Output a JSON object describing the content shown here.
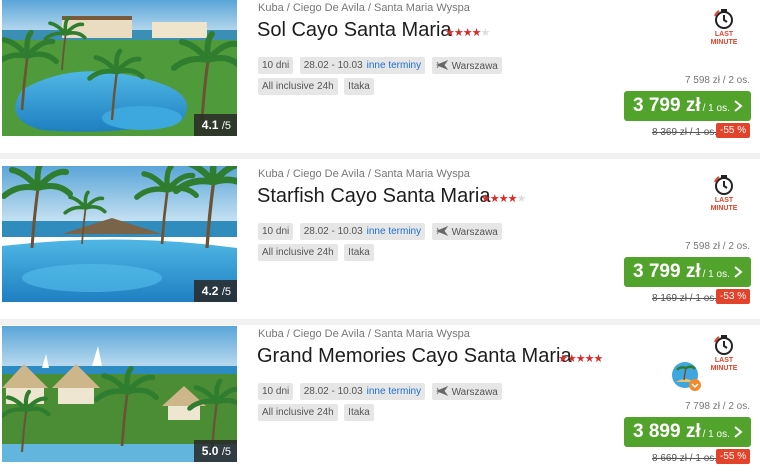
{
  "offers": [
    {
      "breadcrumb": "Kuba / Ciego De Avila / Santa Maria Wyspa",
      "name": "Sol Cayo Santa Maria",
      "stars": 4,
      "stars_max": 5,
      "rating": "4.1",
      "rating_of": "/5",
      "tags": {
        "duration": "10 dni",
        "dates": "28.02 - 10.03",
        "other_dates": "inne terminy",
        "departure": "Warszawa",
        "board": "All inclusive 24h",
        "operator": "Itaka"
      },
      "last_minute": [
        "LAST",
        "MINUTE"
      ],
      "promo_badge": false,
      "per_two": "7 598 zł / 2 os.",
      "price": "3 799 zł",
      "price_unit": "/ 1 os.",
      "old_price": "8 369 zł / 1 os.",
      "discount": "-55 %"
    },
    {
      "breadcrumb": "Kuba / Ciego De Avila / Santa Maria Wyspa",
      "name": "Starfish Cayo Santa Maria",
      "stars": 4,
      "stars_max": 5,
      "rating": "4.2",
      "rating_of": "/5",
      "tags": {
        "duration": "10 dni",
        "dates": "28.02 - 10.03",
        "other_dates": "inne terminy",
        "departure": "Warszawa",
        "board": "All inclusive 24h",
        "operator": "Itaka"
      },
      "last_minute": [
        "LAST",
        "MINUTE"
      ],
      "promo_badge": false,
      "per_two": "7 598 zł / 2 os.",
      "price": "3 799 zł",
      "price_unit": "/ 1 os.",
      "old_price": "8 169 zł / 1 os.",
      "discount": "-53 %"
    },
    {
      "breadcrumb": "Kuba / Ciego De Avila / Santa Maria Wyspa",
      "name": "Grand Memories Cayo Santa Maria",
      "stars": 5,
      "stars_max": 5,
      "rating": "5.0",
      "rating_of": "/5",
      "tags": {
        "duration": "10 dni",
        "dates": "28.02 - 10.03",
        "other_dates": "inne terminy",
        "departure": "Warszawa",
        "board": "All inclusive 24h",
        "operator": "Itaka"
      },
      "last_minute": [
        "LAST",
        "MINUTE"
      ],
      "promo_badge": true,
      "per_two": "7 798 zł / 2 os.",
      "price": "3 899 zł",
      "price_unit": "/ 1 os.",
      "old_price": "8 669 zł / 1 os.",
      "discount": "-55 %"
    }
  ],
  "colors": {
    "price_button": "#52a32c",
    "discount": "#e2432b",
    "stars": "#d72c2c",
    "link": "#1f6fd1"
  },
  "icons": {
    "plane": "plane-icon",
    "clock": "last-minute-clock-icon",
    "chevron": "chevron-right-icon",
    "promo": "promo-island-icon"
  }
}
